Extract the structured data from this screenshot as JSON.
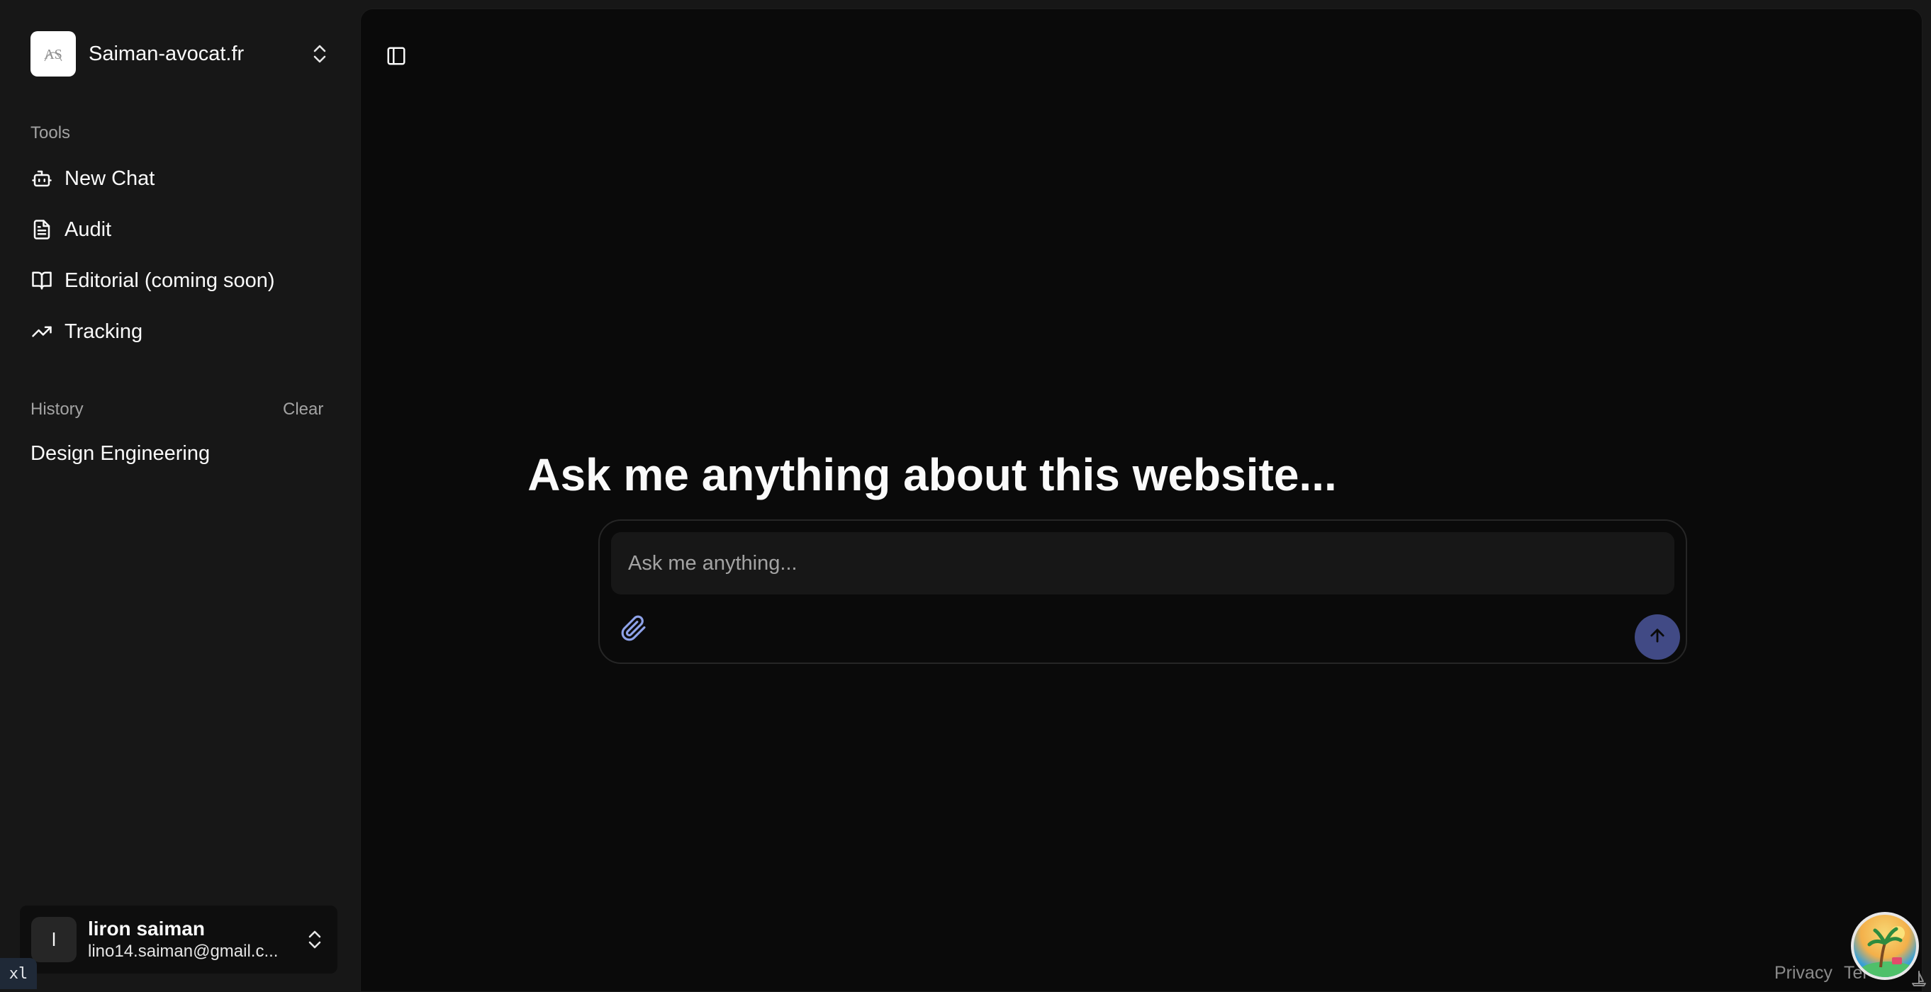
{
  "org": {
    "name": "Saiman-avocat.fr",
    "logo_text": "AS"
  },
  "sidebar": {
    "tools_label": "Tools",
    "tools": [
      {
        "label": "New Chat",
        "icon": "bot-icon"
      },
      {
        "label": "Audit",
        "icon": "file-text-icon"
      },
      {
        "label": "Editorial (coming soon)",
        "icon": "book-open-icon"
      },
      {
        "label": "Tracking",
        "icon": "trending-up-icon"
      }
    ],
    "history_label": "History",
    "clear_label": "Clear",
    "history": [
      {
        "label": "Design Engineering"
      }
    ]
  },
  "user": {
    "initial": "l",
    "name": "liron saiman",
    "email": "lino14.saiman@gmail.c..."
  },
  "breakpoint_badge": "xl",
  "main": {
    "heading": "Ask me anything about this website...",
    "input_placeholder": "Ask me anything...",
    "input_value": ""
  },
  "footer": {
    "privacy": "Privacy",
    "terms": "Ter"
  },
  "colors": {
    "sidebar_bg": "#171717",
    "main_bg": "#0a0a0a",
    "send_button": "#414a85",
    "attach_icon": "#8ea2e8"
  }
}
